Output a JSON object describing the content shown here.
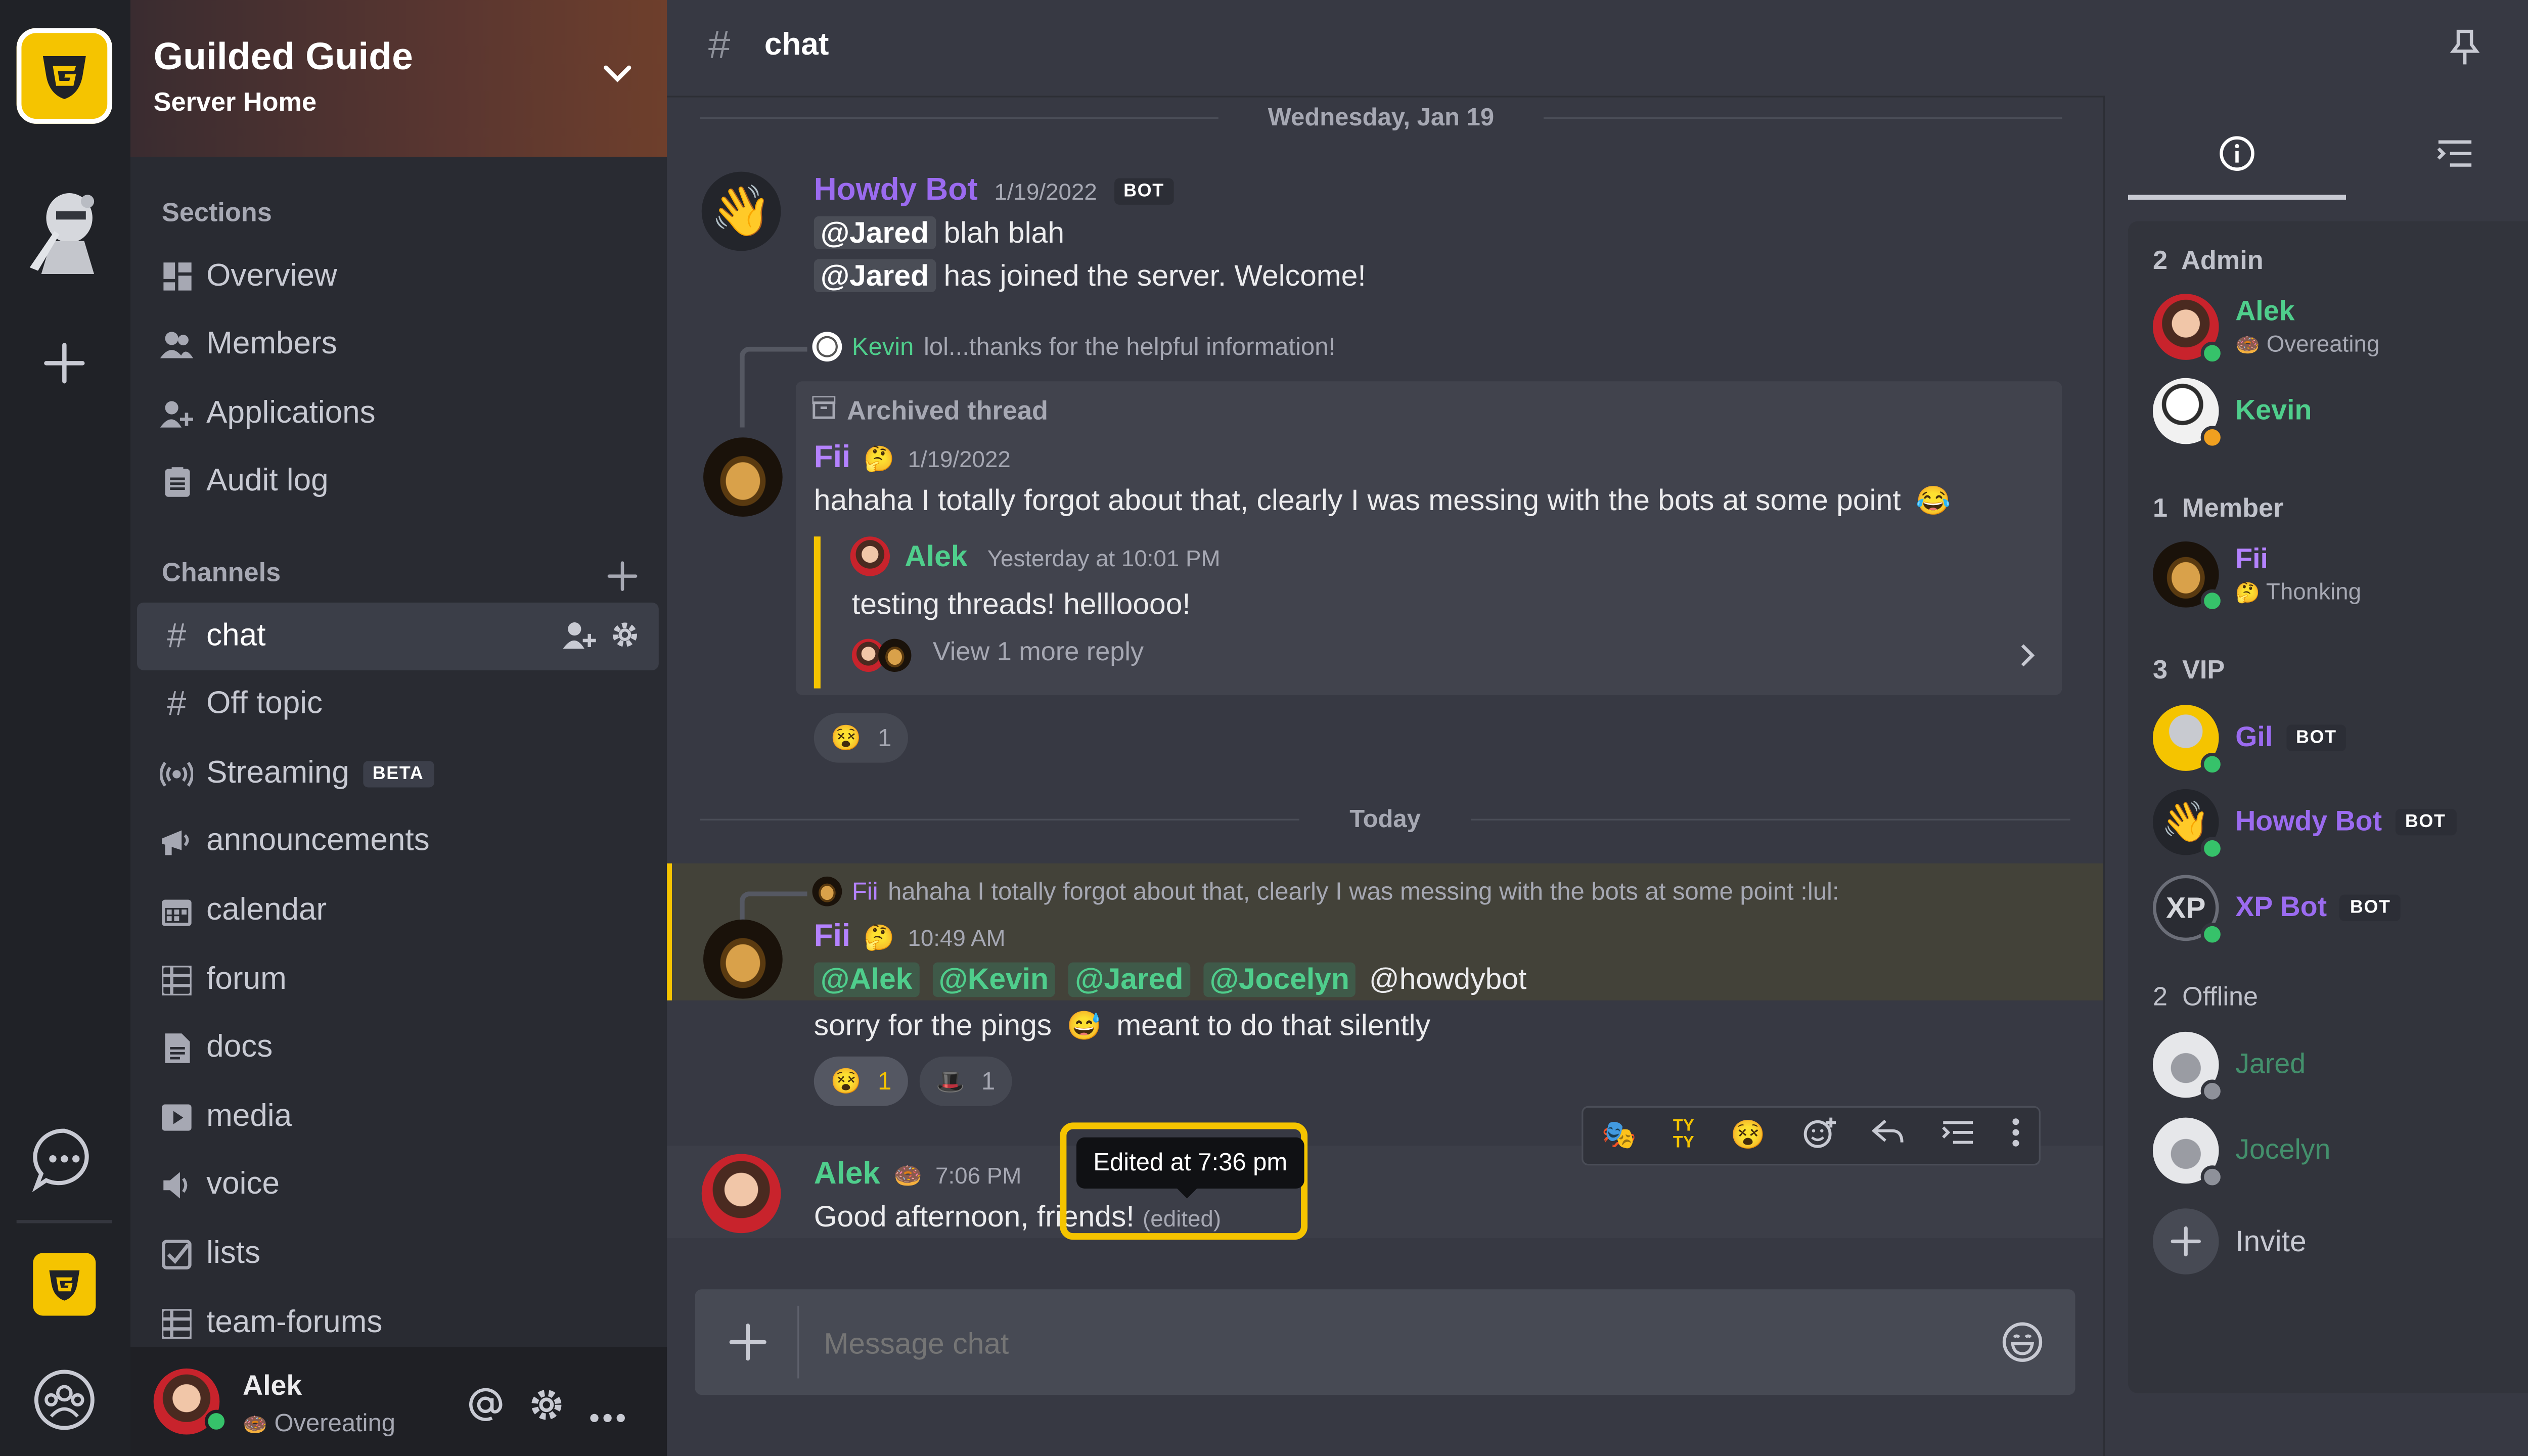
{
  "colors": {
    "accent": "#f5c400",
    "online": "#36c26a",
    "idle": "#f0a020",
    "offline": "#8e919a",
    "bot_purple": "#9b6bf0",
    "admin_green": "#4fce8c",
    "member_purple": "#b482ff"
  },
  "server": {
    "name": "Guilded Guide",
    "subtitle": "Server Home"
  },
  "rail": {
    "icons": [
      "guilded-logo-icon",
      "knight-avatar-icon",
      "add-server-icon",
      "chat-bubble-icon",
      "guilded-server-icon",
      "community-icon"
    ]
  },
  "sections": {
    "title": "Sections",
    "items": [
      {
        "label": "Overview",
        "icon": "overview-icon"
      },
      {
        "label": "Members",
        "icon": "members-icon"
      },
      {
        "label": "Applications",
        "icon": "applications-icon"
      },
      {
        "label": "Audit log",
        "icon": "audit-log-icon"
      }
    ]
  },
  "channels": {
    "title": "Channels",
    "items": [
      {
        "label": "chat",
        "icon": "hash-icon",
        "active": true
      },
      {
        "label": "Off topic",
        "icon": "hash-icon"
      },
      {
        "label": "Streaming",
        "icon": "streaming-icon",
        "badge": "BETA"
      },
      {
        "label": "announcements",
        "icon": "megaphone-icon"
      },
      {
        "label": "calendar",
        "icon": "calendar-icon"
      },
      {
        "label": "forum",
        "icon": "forum-icon"
      },
      {
        "label": "docs",
        "icon": "docs-icon"
      },
      {
        "label": "media",
        "icon": "media-icon"
      },
      {
        "label": "voice",
        "icon": "voice-icon"
      },
      {
        "label": "lists",
        "icon": "lists-icon"
      },
      {
        "label": "team-forums",
        "icon": "forum-icon"
      }
    ]
  },
  "user": {
    "name": "Alek",
    "status": "Overeating",
    "status_emoji": "🍩"
  },
  "channel_header": {
    "hash": "#",
    "name": "chat"
  },
  "messages": {
    "date1": "Wednesday, Jan 19",
    "date2": "Today",
    "m1": {
      "author": "Howdy Bot",
      "time": "1/19/2022",
      "bot_badge": "BOT",
      "line1_mention": "@Jared",
      "line1_text": "blah blah",
      "line2_mention": "@Jared",
      "line2_text": "has joined the server. Welcome!"
    },
    "m2": {
      "reply_author": "Kevin",
      "reply_text": "lol...thanks for the helpful information!",
      "archived_label": "Archived thread",
      "author": "Fii",
      "time": "1/19/2022",
      "text": "hahaha I totally forgot about that, clearly I was messing with the bots at some point",
      "thread_author": "Alek",
      "thread_time": "Yesterday at 10:01 PM",
      "thread_text": "testing threads! hellloooo!",
      "thread_more": "View 1 more reply",
      "reaction_count": "1"
    },
    "m3": {
      "reply_author": "Fii",
      "reply_text": "hahaha I totally forgot about that, clearly I was messing with the bots at some point :lul:",
      "author": "Fii",
      "time": "10:49 AM",
      "mentions": [
        "@Alek",
        "@Kevin",
        "@Jared",
        "@Jocelyn"
      ],
      "plain_mention": "@howdybot",
      "text_before": "sorry for the pings",
      "text_after": "meant to do that silently",
      "reaction1_count": "1",
      "reaction2_count": "1"
    },
    "m4": {
      "author": "Alek",
      "time": "7:06 PM",
      "text": "Good afternoon, friends!",
      "edited": "(edited)"
    },
    "tooltip": "Edited at 7:36 pm",
    "toolbar_icons": [
      "reaction-redhat-icon",
      "tyty-icon",
      "reaction-face-icon",
      "add-reaction-icon",
      "reply-icon",
      "thread-icon",
      "more-icon"
    ],
    "tyty": "TY\nTY"
  },
  "composer": {
    "placeholder": "Message chat"
  },
  "members": {
    "sections": [
      {
        "count": "2",
        "label": "Admin"
      },
      {
        "count": "1",
        "label": "Member"
      },
      {
        "count": "3",
        "label": "VIP"
      },
      {
        "count": "2",
        "label": "Offline"
      }
    ],
    "list": [
      {
        "name": "Alek",
        "status": "Overeating",
        "emoji": "🍩"
      },
      {
        "name": "Kevin"
      },
      {
        "name": "Fii",
        "status": "Thonking",
        "emoji": "🤔"
      },
      {
        "name": "Gil",
        "badge": "BOT"
      },
      {
        "name": "Howdy Bot",
        "badge": "BOT"
      },
      {
        "name": "XP Bot",
        "badge": "BOT",
        "avatar_text": "XP"
      },
      {
        "name": "Jared"
      },
      {
        "name": "Jocelyn"
      }
    ],
    "invite": "Invite"
  }
}
